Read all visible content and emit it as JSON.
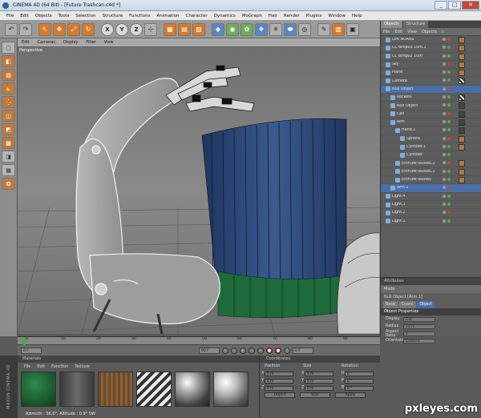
{
  "window": {
    "title": "CINEMA 4D (64 Bit) - [Future Trashcan.c4d *]",
    "buttons": [
      "_",
      "□",
      "✕"
    ]
  },
  "menubar": [
    "File",
    "Edit",
    "Objects",
    "Tools",
    "Selection",
    "Structure",
    "Functions",
    "Animation",
    "Character",
    "Dynamics",
    "MoGraph",
    "Hair",
    "Render",
    "Plugins",
    "Window",
    "Help"
  ],
  "toolbar_icons": [
    "undo-icon",
    "redo-icon",
    "live-select-icon",
    "move-icon",
    "scale-icon",
    "rotate-icon",
    "x-axis-icon",
    "y-axis-icon",
    "z-axis-icon",
    "coordinate-system-icon",
    "render-view-icon",
    "render-picture-viewer-icon",
    "render-settings-icon",
    "cube-icon",
    "nurbs-icon",
    "array-icon",
    "deformer-icon",
    "scene-icon",
    "light-icon",
    "camera-icon",
    "material-icon"
  ],
  "toolbar_axes": [
    "X",
    "Y",
    "Z"
  ],
  "viewport": {
    "menu": [
      "Edit",
      "Cameras",
      "Display",
      "Filter",
      "View"
    ],
    "label": "Perspective"
  },
  "objects": {
    "tabs": [
      "Objects",
      "Structure"
    ],
    "menu": [
      "File",
      "Edit",
      "View",
      "Objects"
    ],
    "rows": [
      {
        "name": "Loft NURBS",
        "indent": 1,
        "tag": "o",
        "selected": false
      },
      {
        "name": "CL lamp02 10m.1",
        "indent": 1,
        "tag": "o",
        "selected": false
      },
      {
        "name": "CL lamp02 10m",
        "indent": 1,
        "tag": "o",
        "selected": false
      },
      {
        "name": "Sky",
        "indent": 1,
        "tag": "o",
        "selected": false
      },
      {
        "name": "Plane",
        "indent": 1,
        "tag": "o",
        "selected": false
      },
      {
        "name": "Camera",
        "indent": 1,
        "tag": "k",
        "selected": false
      },
      {
        "name": "Null Object",
        "indent": 1,
        "tag": "e",
        "selected": true
      },
      {
        "name": "Rockets",
        "indent": 2,
        "tag": "k",
        "selected": false
      },
      {
        "name": "Null Object",
        "indent": 2,
        "tag": "d",
        "selected": false
      },
      {
        "name": "Can",
        "indent": 2,
        "tag": "d",
        "selected": false
      },
      {
        "name": "Arm",
        "indent": 2,
        "tag": "d",
        "selected": false
      },
      {
        "name": "Hand.1",
        "indent": 3,
        "tag": "d",
        "selected": false
      },
      {
        "name": "Sphere",
        "indent": 4,
        "tag": "o",
        "selected": false
      },
      {
        "name": "Cylinder.1",
        "indent": 4,
        "tag": "o",
        "selected": false
      },
      {
        "name": "Cylinder",
        "indent": 4,
        "tag": "e",
        "selected": false
      },
      {
        "name": "Extrude NURBS.2",
        "indent": 3,
        "tag": "o",
        "selected": false
      },
      {
        "name": "Extrude NURBS.1",
        "indent": 3,
        "tag": "o",
        "selected": false
      },
      {
        "name": "Extrude NURBS",
        "indent": 3,
        "tag": "o",
        "selected": false
      },
      {
        "name": "Arm.1",
        "indent": 2,
        "tag": "e",
        "selected": true
      },
      {
        "name": "Light.4",
        "indent": 1,
        "tag": "e",
        "selected": false
      },
      {
        "name": "Light.3",
        "indent": 1,
        "tag": "e",
        "selected": false
      },
      {
        "name": "Light.2",
        "indent": 1,
        "tag": "e",
        "selected": false
      },
      {
        "name": "Light.1",
        "indent": 1,
        "tag": "e",
        "selected": false
      }
    ]
  },
  "attributes": {
    "header": "Attributes",
    "mode": "Mode",
    "object_name": "Null Object [Arm.1]",
    "tabs": [
      "Basic",
      "Coord.",
      "Object"
    ],
    "section": "Object Properties",
    "props": [
      {
        "label": "Display",
        "value": "Dot"
      },
      {
        "label": "Radius",
        "value": "10 m"
      },
      {
        "label": "Aspect Ratio",
        "value": "1"
      },
      {
        "label": "Orientation",
        "value": "Camera"
      }
    ]
  },
  "timeline": {
    "ticks": [
      "0",
      "10",
      "20",
      "30",
      "40",
      "50",
      "60",
      "70",
      "80",
      "90"
    ],
    "current": "0 F",
    "start": "0 F",
    "end": "90 F",
    "end_right": "0 F"
  },
  "materials": {
    "header": "Materials",
    "menu": [
      "File",
      "Edit",
      "Function",
      "Texture"
    ],
    "status": "Azimuth : 56.0°, Altitude : 0.9°  SW"
  },
  "coordinates": {
    "header": "Coordinates",
    "columns": [
      "Position",
      "Size",
      "Rotation"
    ],
    "rows": [
      {
        "axis": "X",
        "pos": "0 m",
        "size": "0 m",
        "rot_label": "H",
        "rot": "0 °"
      },
      {
        "axis": "Y",
        "pos": "0 m",
        "size": "0 m",
        "rot_label": "P",
        "rot": "0 °"
      },
      {
        "axis": "Z",
        "pos": "0 m",
        "size": "0 m",
        "rot_label": "B",
        "rot": "0 °"
      }
    ],
    "buttons": [
      "Object",
      "Size",
      "Apply"
    ]
  },
  "brand": "MAXON CINEMA 4D",
  "watermark": "pxleyes.com"
}
